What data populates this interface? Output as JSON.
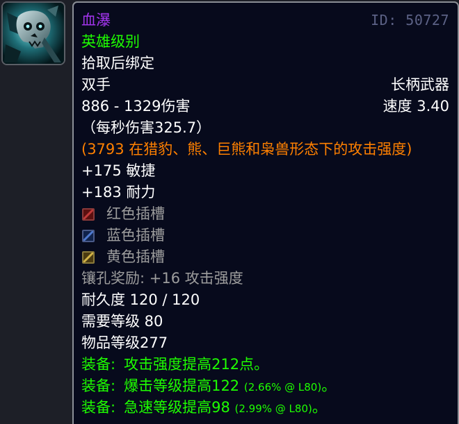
{
  "item": {
    "name": "血瀑",
    "id_label": "ID: 50727",
    "quality": "英雄级别",
    "bind": "拾取后绑定",
    "slot": "双手",
    "weapon_type": "长柄武器",
    "damage": "886 - 1329伤害",
    "speed": "速度 3.40",
    "dps": "（每秒伤害325.7）",
    "feral_ap": "(3793 在猎豹、熊、巨熊和枭兽形态下的攻击强度)",
    "stats": [
      "+175 敏捷",
      "+183 耐力"
    ],
    "sockets": [
      {
        "label": "红色插槽",
        "color": "#c23a3a"
      },
      {
        "label": "蓝色插槽",
        "color": "#4f7ad0"
      },
      {
        "label": "黄色插槽",
        "color": "#d2b448"
      }
    ],
    "socket_bonus": "镶孔奖励: +16 攻击强度",
    "durability": "耐久度 120 / 120",
    "required_level": "需要等级 80",
    "item_level": "物品等级277",
    "equip": [
      {
        "prefix": "装备:",
        "text": "攻击强度提高212点。",
        "detail": "",
        "suffix": ""
      },
      {
        "prefix": "装备:",
        "text": "爆击等级提高122",
        "detail": "(2.66% @ L80)",
        "suffix": "。"
      },
      {
        "prefix": "装备:",
        "text": "急速等级提高98",
        "detail": "(2.99% @ L80)",
        "suffix": "。"
      }
    ]
  },
  "icon": {
    "name": "blade-skull-icon"
  },
  "colors": {
    "epic": "#a335ee",
    "uncommon": "#1eff00",
    "orange": "#ff8000",
    "grey": "#9d9d9d",
    "background": "#070a1c"
  }
}
